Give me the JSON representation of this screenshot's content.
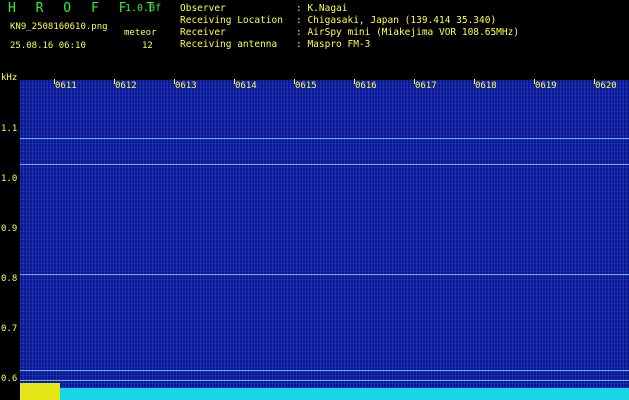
{
  "header": {
    "logo": "H R O F F T",
    "version": "1.0.0f",
    "filename": "KN9_2508160610.png",
    "meteor_label": "meteor",
    "datetime": "25.08.16 06:10",
    "meteor_count": "12",
    "info": [
      {
        "label": "Observer",
        "value": ": K.Nagai"
      },
      {
        "label": "Receiving Location",
        "value": ": Chigasaki, Japan (139.414 35.340)"
      },
      {
        "label": "Receiver",
        "value": ": AirSpy mini (Miakejima VOR 108.65MHz)"
      },
      {
        "label": "Receiving antenna",
        "value": ": Maspro FM-3"
      }
    ]
  },
  "axis": {
    "unit": "kHz",
    "y_labels": [
      "1.1",
      "1.0",
      "0.9",
      "0.8",
      "0.7",
      "0.6"
    ],
    "x_labels": [
      "0611",
      "0612",
      "0613",
      "0614",
      "0615",
      "0616",
      "0617",
      "0618",
      "0619",
      "0620"
    ]
  },
  "colors": {
    "background": "#0a1890",
    "label": "#ffff44",
    "logo": "#33ee33",
    "trace": "#19d6e6"
  }
}
